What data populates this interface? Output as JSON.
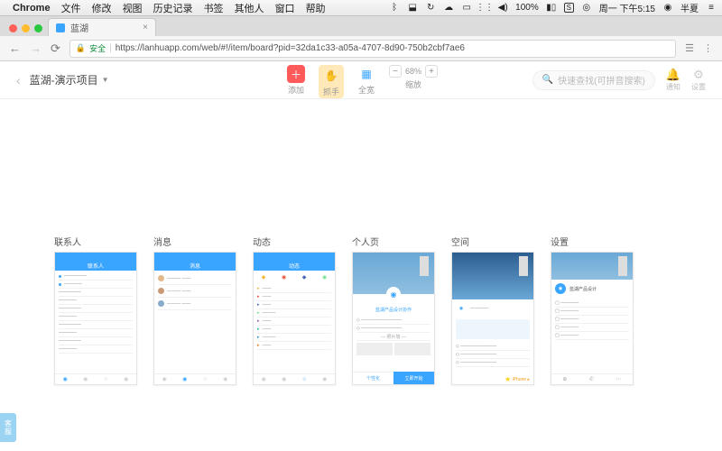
{
  "mac_menu": {
    "app": "Chrome",
    "items": [
      "文件",
      "修改",
      "视图",
      "历史记录",
      "书签",
      "其他人",
      "窗口",
      "帮助"
    ],
    "right": {
      "battery": "100%",
      "ime": "S",
      "clock": "周一 下午5:15",
      "user": "半夏"
    }
  },
  "browser": {
    "tab_title": "蓝湖",
    "url": "https://lanhuapp.com/web/#!/item/board?pid=32da1c33-a05a-4707-8d90-750b2cbf7ae6",
    "secure_label": "安全"
  },
  "header": {
    "back": "‹",
    "project_name": "蓝湖-演示项目",
    "tools": {
      "add": "添加",
      "hand": "抓手",
      "full": "全宽",
      "zoom_label": "缩放",
      "zoom_value": "68%"
    },
    "search_placeholder": "快速查找(可拼音搜索)",
    "right": {
      "notify": "通知",
      "settings": "设置"
    }
  },
  "screens": [
    {
      "label": "联系人",
      "type": "list_blue"
    },
    {
      "label": "消息",
      "type": "chat"
    },
    {
      "label": "动态",
      "type": "categories"
    },
    {
      "label": "个人页",
      "type": "profile",
      "title": "蓝湖产品设计协作"
    },
    {
      "label": "空间",
      "type": "space"
    },
    {
      "label": "设置",
      "type": "settings",
      "title": "蓝湖产品设计"
    }
  ],
  "cs_float": "客服"
}
